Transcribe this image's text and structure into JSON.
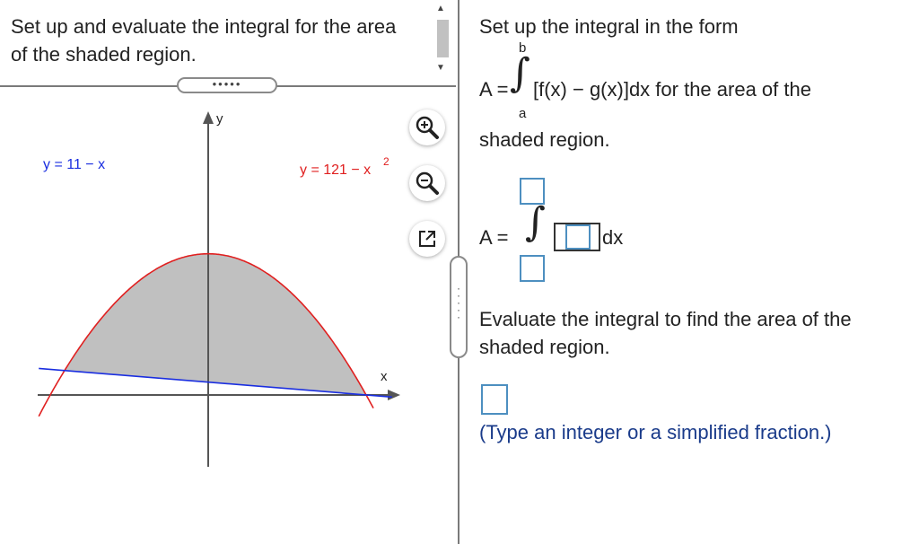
{
  "left_panel": {
    "question": "Set up and evaluate the integral for the area of the shaded region.",
    "divider_handle": "•••••",
    "graph": {
      "y_axis_label": "y",
      "x_axis_label": "x",
      "line_label": "y = 11 − x",
      "parabola_label": "y = 121 − x",
      "parabola_label_exp": "2",
      "parabola_color": "#e02020",
      "line_color": "#1a2ee0",
      "shade_color": "#c0c0c0"
    },
    "tools": {
      "zoom_in_icon": "zoom-in-icon",
      "zoom_out_icon": "zoom-out-icon",
      "popout_icon": "popout-icon"
    }
  },
  "right_panel": {
    "instruction": "Set up the integral in the form",
    "formula_prefix": "A =",
    "formula_upper": "b",
    "formula_lower": "a",
    "formula_body": "[f(x) − g(x)]dx for the area of the",
    "instruction_end": "shaded region.",
    "answer_prefix": "A =",
    "answer_dx": "dx",
    "evaluate_line1": "Evaluate the integral to find the area of the",
    "evaluate_line2": "shaded region.",
    "hint": "(Type an integer or a simplified fraction.)"
  }
}
